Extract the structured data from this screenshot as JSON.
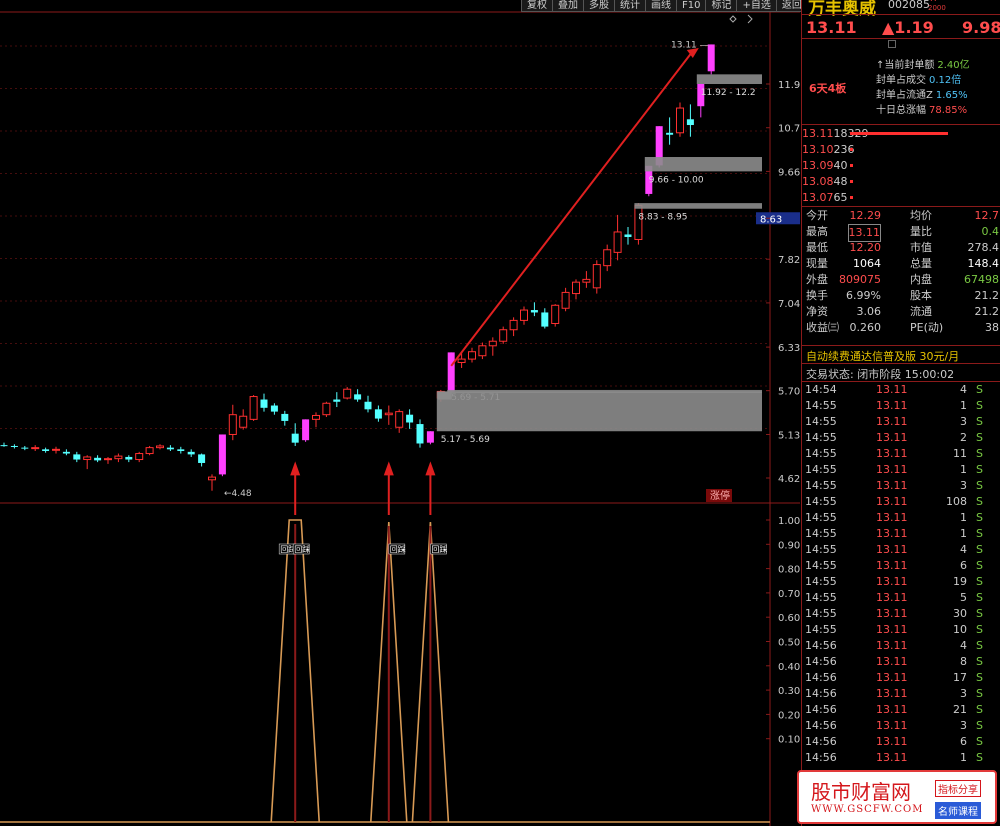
{
  "toolbar": [
    "复权",
    "叠加",
    "多股",
    "统计",
    "画线",
    "F10",
    "标记",
    "+自选",
    "返回"
  ],
  "stock": {
    "name": "万丰奥威",
    "code": "002085",
    "r_mark": "R",
    "r_sub": "2000",
    "price": "13.11",
    "change": "▲1.19",
    "pct": "9.98%"
  },
  "seal": {
    "tag": "6天4板",
    "rows": [
      {
        "label": "当前封单额",
        "value": "2.40亿",
        "color": "#7ac943",
        "arrow": "↑"
      },
      {
        "label": "封单占成交",
        "value": "0.12倍",
        "color": "#4fc3f7",
        "arrow": ""
      },
      {
        "label": "封单占流通Z",
        "value": "1.65%",
        "color": "#4fc3f7",
        "arrow": ""
      },
      {
        "label": "十日总涨幅",
        "value": "78.85%",
        "color": "#ff4d4d",
        "arrow": ""
      }
    ]
  },
  "quotes": [
    {
      "price": "13.11",
      "vol": "18329",
      "bar": true
    },
    {
      "price": "13.10",
      "vol": "236",
      "bar": false
    },
    {
      "price": "13.09",
      "vol": "40",
      "bar": false
    },
    {
      "price": "13.08",
      "vol": "48",
      "bar": false
    },
    {
      "price": "13.07",
      "vol": "65",
      "bar": false
    }
  ],
  "stats": [
    {
      "l1": "今开",
      "v1": "12.29",
      "c1": "#ff4d4d",
      "l2": "均价",
      "v2": "12.7",
      "c2": "#ff4d4d",
      "box": false
    },
    {
      "l1": "最高",
      "v1": "13.11",
      "c1": "#ff4d4d",
      "l2": "量比",
      "v2": "0.4",
      "c2": "#7ac943",
      "box": true
    },
    {
      "l1": "最低",
      "v1": "12.20",
      "c1": "#ff4d4d",
      "l2": "市值",
      "v2": "278.4",
      "c2": "#ccc",
      "box": false
    },
    {
      "l1": "现量",
      "v1": "1064",
      "c1": "#fff",
      "l2": "总量",
      "v2": "148.4",
      "c2": "#fff",
      "box": false
    },
    {
      "l1": "外盘",
      "v1": "809075",
      "c1": "#ff4d4d",
      "l2": "内盘",
      "v2": "67498",
      "c2": "#7ac943",
      "box": false
    },
    {
      "l1": "换手",
      "v1": "6.99%",
      "c1": "#ccc",
      "l2": "股本",
      "v2": "21.2",
      "c2": "#ccc",
      "box": false
    },
    {
      "l1": "净资",
      "v1": "3.06",
      "c1": "#ccc",
      "l2": "流通",
      "v2": "21.2",
      "c2": "#ccc",
      "box": false
    },
    {
      "l1": "收益㈢",
      "v1": "0.260",
      "c1": "#ccc",
      "l2": "PE(动)",
      "v2": "38",
      "c2": "#ccc",
      "box": false
    }
  ],
  "sector": "自动续费通达信普及版   30元/月",
  "trade_status": "交易状态: 闭市阶段 15:00:02",
  "ticks": [
    [
      "14:54",
      "13.11",
      "4",
      "S"
    ],
    [
      "14:55",
      "13.11",
      "1",
      "S"
    ],
    [
      "14:55",
      "13.11",
      "3",
      "S"
    ],
    [
      "14:55",
      "13.11",
      "2",
      "S"
    ],
    [
      "14:55",
      "13.11",
      "11",
      "S"
    ],
    [
      "14:55",
      "13.11",
      "1",
      "S"
    ],
    [
      "14:55",
      "13.11",
      "3",
      "S"
    ],
    [
      "14:55",
      "13.11",
      "108",
      "S"
    ],
    [
      "14:55",
      "13.11",
      "1",
      "S"
    ],
    [
      "14:55",
      "13.11",
      "1",
      "S"
    ],
    [
      "14:55",
      "13.11",
      "4",
      "S"
    ],
    [
      "14:55",
      "13.11",
      "6",
      "S"
    ],
    [
      "14:55",
      "13.11",
      "19",
      "S"
    ],
    [
      "14:55",
      "13.11",
      "5",
      "S"
    ],
    [
      "14:55",
      "13.11",
      "30",
      "S"
    ],
    [
      "14:55",
      "13.11",
      "10",
      "S"
    ],
    [
      "14:56",
      "13.11",
      "4",
      "S"
    ],
    [
      "14:56",
      "13.11",
      "8",
      "S"
    ],
    [
      "14:56",
      "13.11",
      "17",
      "S"
    ],
    [
      "14:56",
      "13.11",
      "3",
      "S"
    ],
    [
      "14:56",
      "13.11",
      "21",
      "S"
    ],
    [
      "14:56",
      "13.11",
      "3",
      "S"
    ],
    [
      "14:56",
      "13.11",
      "6",
      "S"
    ],
    [
      "14:56",
      "13.11",
      "1",
      "S"
    ]
  ],
  "chart": {
    "price_ticks": [
      "11.92",
      "10.73",
      "9.66",
      "8.63",
      "7.82",
      "7.04",
      "6.33",
      "5.70",
      "5.13",
      "4.62"
    ],
    "price_hilite": "8.63",
    "ind_ticks": [
      "1.00",
      "0.90",
      "0.80",
      "0.70",
      "0.60",
      "0.50",
      "0.40",
      "0.30",
      "0.20",
      "0.10"
    ],
    "labels": {
      "high": "13.11",
      "low": "4.48",
      "ztb": "涨停"
    },
    "zones": [
      "11.92 - 12.2",
      "9.66 - 10.00",
      "8.83 - 8.95",
      "5.69 - 5.71",
      "5.17 - 5.69"
    ],
    "signal": "回踩",
    "colors": {
      "up": "#ff3030",
      "down": "#54ffff",
      "limit": "#ff40ff",
      "green": "#00d000",
      "zone": "#8c8c8c",
      "arrow": "#e02020",
      "ind": "#d89a55"
    }
  },
  "watermark": {
    "name": "股市财富网",
    "url": "WWW.GSCFW.COM",
    "tag1": "指标分享",
    "tag2": "名师课程"
  }
}
